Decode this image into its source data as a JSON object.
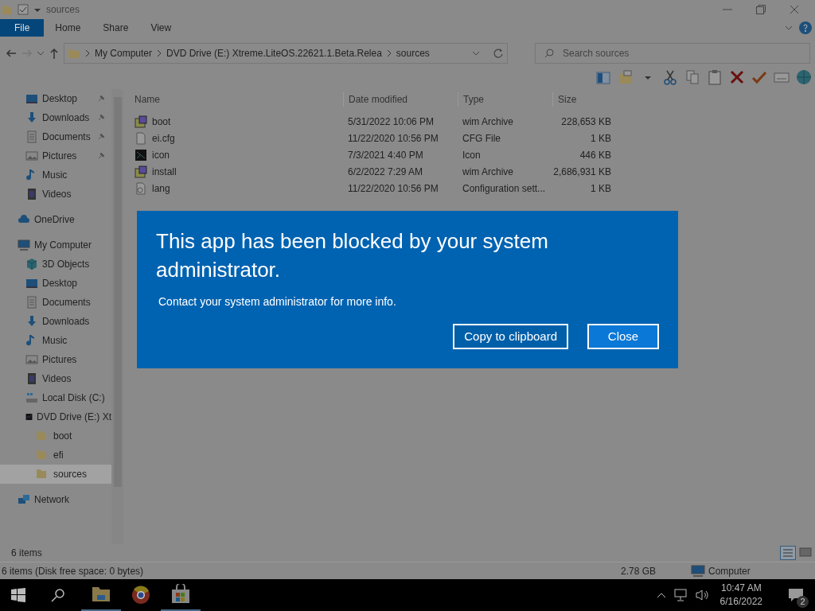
{
  "window": {
    "title": "sources"
  },
  "ribbon_tabs": [
    {
      "label": "File",
      "kind": "file"
    },
    {
      "label": "Home",
      "kind": "tab"
    },
    {
      "label": "Share",
      "kind": "tab"
    },
    {
      "label": "View",
      "kind": "tab"
    }
  ],
  "address_bar": {
    "breadcrumbs": [
      "My Computer",
      "DVD Drive (E:) Xtreme.LiteOS.22621.1.Beta.Relea",
      "sources"
    ]
  },
  "search": {
    "placeholder": "Search sources"
  },
  "nav_pane": {
    "pinned_items": [
      {
        "label": "Desktop",
        "kind": "desktop",
        "pinned": true
      },
      {
        "label": "Downloads",
        "kind": "downloads",
        "pinned": true
      },
      {
        "label": "Documents",
        "kind": "documents",
        "pinned": true
      },
      {
        "label": "Pictures",
        "kind": "pictures",
        "pinned": true
      },
      {
        "label": "Music",
        "kind": "music",
        "pinned": false
      },
      {
        "label": "Videos",
        "kind": "videos",
        "pinned": false
      }
    ],
    "tree": [
      {
        "label": "OneDrive",
        "kind": "cloud",
        "selected": false
      },
      {
        "label": "My Computer",
        "kind": "computer",
        "selected": false,
        "children": [
          {
            "label": "3D Objects",
            "kind": "cube",
            "selected": false
          },
          {
            "label": "Desktop",
            "kind": "desktop",
            "selected": false
          },
          {
            "label": "Documents",
            "kind": "documents",
            "selected": false
          },
          {
            "label": "Downloads",
            "kind": "downloads",
            "selected": false
          },
          {
            "label": "Music",
            "kind": "music",
            "selected": false
          },
          {
            "label": "Pictures",
            "kind": "pictures",
            "selected": false
          },
          {
            "label": "Videos",
            "kind": "videos",
            "selected": false
          },
          {
            "label": "Local Disk (C:)",
            "kind": "disk",
            "selected": false
          },
          {
            "label": "DVD Drive (E:) Xt",
            "kind": "dvd",
            "selected": false,
            "children": [
              {
                "label": "boot",
                "kind": "folder",
                "selected": false
              },
              {
                "label": "efi",
                "kind": "folder",
                "selected": false
              },
              {
                "label": "sources",
                "kind": "folder",
                "selected": true
              }
            ]
          }
        ]
      },
      {
        "label": "Network",
        "kind": "network",
        "selected": false
      }
    ]
  },
  "file_list": {
    "columns": [
      "Name",
      "Date modified",
      "Type",
      "Size"
    ],
    "rows": [
      {
        "name": "boot",
        "date_modified": "5/31/2022 10:06 PM",
        "type": "wim Archive",
        "size": "228,653 KB",
        "kind": "archive"
      },
      {
        "name": "ei.cfg",
        "date_modified": "11/22/2020 10:56 PM",
        "type": "CFG File",
        "size": "1 KB",
        "kind": "file"
      },
      {
        "name": "icon",
        "date_modified": "7/3/2021 4:40 PM",
        "type": "Icon",
        "size": "446 KB",
        "kind": "image"
      },
      {
        "name": "install",
        "date_modified": "6/2/2022 7:29 AM",
        "type": "wim Archive",
        "size": "2,686,931 KB",
        "kind": "archive"
      },
      {
        "name": "lang",
        "date_modified": "11/22/2020 10:56 PM",
        "type": "Configuration sett...",
        "size": "1 KB",
        "kind": "settings"
      }
    ]
  },
  "item_count": "6 items",
  "status_bar": {
    "summary": "6 items (Disk free space: 0 bytes)",
    "size": "2.78 GB",
    "location": "Computer"
  },
  "dialog": {
    "title": "This app has been blocked by your system administrator.",
    "message": "Contact your system administrator for more info.",
    "buttons": [
      {
        "label": "Copy to clipboard",
        "kind": "secondary"
      },
      {
        "label": "Close",
        "kind": "primary"
      }
    ]
  },
  "taskbar": {
    "apps": [
      {
        "kind": "explorer",
        "running": true
      },
      {
        "kind": "browser",
        "running": false
      },
      {
        "kind": "store",
        "running": true
      }
    ],
    "time": "10:47 AM",
    "date": "6/16/2022",
    "notification_count": "2"
  }
}
